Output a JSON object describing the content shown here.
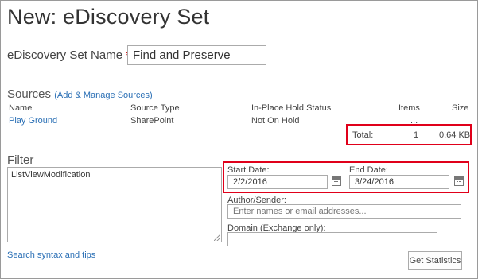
{
  "page": {
    "title": "New: eDiscovery Set"
  },
  "form": {
    "name_label": "eDiscovery Set Name",
    "required_marker": "*",
    "name_value": "Find and Preserve"
  },
  "sources": {
    "heading": "Sources",
    "manage_link": "(Add & Manage Sources)",
    "columns": {
      "name": "Name",
      "type": "Source Type",
      "hold": "In-Place Hold Status",
      "items": "Items",
      "size": "Size"
    },
    "rows": [
      {
        "name": "Play Ground",
        "type": "SharePoint",
        "hold": "Not On Hold",
        "items": "...",
        "size": ""
      }
    ],
    "total_label": "Total:",
    "total_items": "1",
    "total_size": "0.64 KB"
  },
  "filter": {
    "heading": "Filter",
    "query": "ListViewModification",
    "syntax_link": "Search syntax and tips",
    "start_label": "Start Date:",
    "start_value": "2/2/2016",
    "end_label": "End Date:",
    "end_value": "3/24/2016",
    "author_label": "Author/Sender:",
    "author_placeholder": "Enter names or email addresses...",
    "domain_label": "Domain (Exchange only):",
    "domain_value": ""
  },
  "actions": {
    "statistics_label": "Get Statistics"
  },
  "colors": {
    "highlight": "#e0001a",
    "link": "#2a6fb5",
    "required": "#cc0000"
  },
  "icons": {
    "calendar": "calendar-icon",
    "resize": "resize-grip-icon"
  }
}
